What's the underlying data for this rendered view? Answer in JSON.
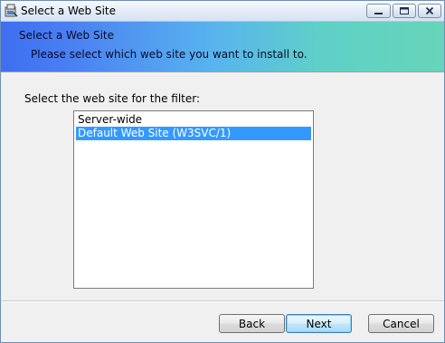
{
  "window": {
    "title": "Select a Web Site",
    "app_icon": "installer-icon",
    "controls": {
      "minimize_icon": "minimize-icon",
      "maximize_icon": "maximize-icon",
      "close_icon": "close-icon"
    }
  },
  "banner": {
    "title": "Select a Web Site",
    "subtitle": "Please select which web site you want to install to."
  },
  "body": {
    "prompt": "Select the web site for the filter:",
    "sites": [
      {
        "label": "Server-wide",
        "selected": false
      },
      {
        "label": "Default Web Site (W3SVC/1)",
        "selected": true
      }
    ]
  },
  "buttons": {
    "back": "Back",
    "next": "Next",
    "cancel": "Cancel"
  },
  "colors": {
    "selection": "#3399ff",
    "banner_start": "#3d6ff0",
    "banner_end": "#67d5b8"
  }
}
